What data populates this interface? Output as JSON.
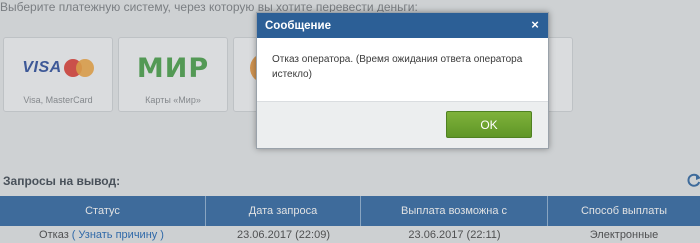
{
  "page": {
    "choose_text": "Выберите платежную систему, через которую вы хотите перевести деньги:"
  },
  "payment_methods": [
    {
      "label": "Visa, MasterCard",
      "logo_text": "VISA"
    },
    {
      "label": "Карты «Мир»",
      "logo_text": "МИР"
    }
  ],
  "withdrawals": {
    "title": "Запросы на вывод:",
    "columns": [
      "Статус",
      "Дата запроса",
      "Выплата возможна с",
      "Способ выплаты"
    ],
    "rows": [
      {
        "status": "Отказ",
        "status_link_open": "(",
        "status_link": "Узнать причину",
        "status_link_close": ")",
        "request_date": "23.06.2017 (22:09)",
        "payout_date": "23.06.2017 (22:11)",
        "method": "Электронные"
      }
    ]
  },
  "modal": {
    "title": "Сообщение",
    "message": "Отказ оператора. (Время ожидания ответа оператора истекло)",
    "ok_label": "OK",
    "close_symbol": "×"
  },
  "colors": {
    "header_blue": "#2c5f96",
    "table_header_blue": "#2f67a3",
    "ok_green": "#6aa22f",
    "link_blue": "#1b64b4"
  },
  "icons": [
    "close-icon",
    "refresh-icon"
  ]
}
